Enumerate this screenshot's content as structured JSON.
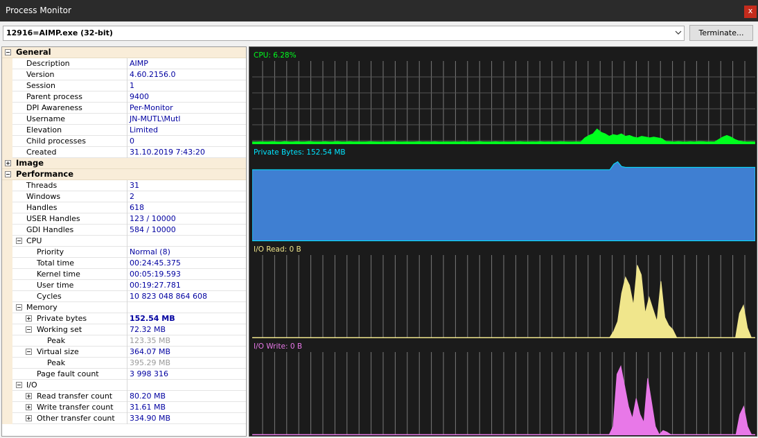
{
  "window": {
    "title": "Process Monitor",
    "close_label": "x"
  },
  "toolbar": {
    "process": "12916=AIMP.exe (32-bit)",
    "terminate_label": "Terminate..."
  },
  "tree": [
    {
      "type": "cat",
      "label": "General",
      "expanded": true
    },
    {
      "label": "Description",
      "value": "AIMP",
      "level": 1
    },
    {
      "label": "Version",
      "value": "4.60.2156.0",
      "level": 1
    },
    {
      "label": "Session",
      "value": "1",
      "level": 1
    },
    {
      "label": "Parent process",
      "value": "9400",
      "level": 1
    },
    {
      "label": "DPI Awareness",
      "value": "Per-Monitor",
      "level": 1
    },
    {
      "label": "Username",
      "value": "JN-MUTL\\Mutl",
      "level": 1
    },
    {
      "label": "Elevation",
      "value": "Limited",
      "level": 1
    },
    {
      "label": "Child processes",
      "value": "0",
      "level": 1
    },
    {
      "label": "Created",
      "value": "31.10.2019 7:43:20",
      "level": 1
    },
    {
      "type": "cat",
      "label": "Image",
      "expanded": false
    },
    {
      "type": "cat",
      "label": "Performance",
      "expanded": true
    },
    {
      "label": "Threads",
      "value": "31",
      "level": 1
    },
    {
      "label": "Windows",
      "value": "2",
      "level": 1
    },
    {
      "label": "Handles",
      "value": "618",
      "level": 1
    },
    {
      "label": "USER Handles",
      "value": "123 / 10000",
      "level": 1
    },
    {
      "label": "GDI Handles",
      "value": "584 / 10000",
      "level": 1
    },
    {
      "label": "CPU",
      "value": "",
      "level": 1,
      "expander": "minus"
    },
    {
      "label": "Priority",
      "value": "Normal (8)",
      "level": 2
    },
    {
      "label": "Total time",
      "value": "00:24:45.375",
      "level": 2
    },
    {
      "label": "Kernel time",
      "value": "00:05:19.593",
      "level": 2
    },
    {
      "label": "User time",
      "value": "00:19:27.781",
      "level": 2
    },
    {
      "label": "Cycles",
      "value": "10 823 048 864 608",
      "level": 2
    },
    {
      "label": "Memory",
      "value": "",
      "level": 1,
      "expander": "minus"
    },
    {
      "label": "Private bytes",
      "value": "152.54 MB",
      "level": 2,
      "expander": "plus",
      "bold": true
    },
    {
      "label": "Working set",
      "value": "72.32 MB",
      "level": 2,
      "expander": "minus"
    },
    {
      "label": "Peak",
      "value": "123.35 MB",
      "level": 3,
      "dim": true
    },
    {
      "label": "Virtual size",
      "value": "364.07 MB",
      "level": 2,
      "expander": "minus"
    },
    {
      "label": "Peak",
      "value": "395.29 MB",
      "level": 3,
      "dim": true
    },
    {
      "label": "Page fault count",
      "value": "3 998 316",
      "level": 2
    },
    {
      "label": "I/O",
      "value": "",
      "level": 1,
      "expander": "minus"
    },
    {
      "label": "Read transfer count",
      "value": "80.20 MB",
      "level": 2,
      "expander": "plus"
    },
    {
      "label": "Write transfer count",
      "value": "31.61 MB",
      "level": 2,
      "expander": "plus"
    },
    {
      "label": "Other transfer count",
      "value": "334.90 MB",
      "level": 2,
      "expander": "plus"
    }
  ],
  "graphs": [
    {
      "title": "CPU: 6.28%",
      "color": "#00ff1e",
      "grid": true,
      "series": [
        2.0,
        1.8,
        2.1,
        2.0,
        1.9,
        2.2,
        2.0,
        1.8,
        2.3,
        2.1,
        2.0,
        2.2,
        1.9,
        2.0,
        2.4,
        2.1,
        2.0,
        1.9,
        2.2,
        2.0,
        2.1,
        2.3,
        2.0,
        1.9,
        2.2,
        2.0,
        2.1,
        1.9,
        2.0,
        2.2,
        2.1,
        2.0,
        1.8,
        2.0,
        2.1,
        2.2,
        2.0,
        1.9,
        2.1,
        2.0,
        2.0,
        2.2,
        1.9,
        2.1,
        2.0,
        2.2,
        2.0,
        1.9,
        2.1,
        2.0,
        2.1,
        2.0,
        2.2,
        1.9,
        2.0,
        2.1,
        2.3,
        2.0,
        2.0,
        1.9,
        2.2,
        2.0,
        2.1,
        2.0,
        2.0,
        2.1,
        2.2,
        2.0,
        1.9,
        2.1,
        2.0,
        2.2,
        2.0,
        2.1,
        1.9,
        2.0,
        2.2,
        2.1,
        2.0,
        2.0,
        2.1,
        2.0,
        7,
        10,
        12,
        18,
        14,
        12,
        9,
        11,
        10,
        12,
        9,
        10,
        8,
        7,
        9,
        8,
        7,
        8,
        7,
        6,
        2.5,
        2.2,
        2.0,
        2.3,
        2.1,
        2.0,
        2.2,
        2.0,
        2.4,
        2.2,
        2.0,
        2.1,
        2.0,
        5,
        8,
        10,
        8,
        5,
        3,
        2.2,
        2.0,
        2.1,
        2.0
      ]
    },
    {
      "title": "Private Bytes: 152.54 MB",
      "color": "#00e5ff",
      "fill": "#3f7fd2",
      "grid": false,
      "series": [
        88,
        88,
        88,
        88,
        88,
        88,
        88,
        88,
        88,
        88,
        88,
        88,
        88,
        88,
        88,
        88,
        88,
        88,
        88,
        88,
        88,
        88,
        88,
        88,
        88,
        88,
        88,
        88,
        88,
        88,
        88,
        88,
        88,
        88,
        88,
        88,
        88,
        88,
        88,
        88,
        88,
        88,
        88,
        88,
        88,
        88,
        88,
        88,
        88,
        88,
        88,
        88,
        88,
        88,
        88,
        88,
        88,
        88,
        88,
        88,
        88,
        88,
        88,
        88,
        88,
        88,
        88,
        88,
        88,
        88,
        88,
        88,
        88,
        88,
        88,
        88,
        88,
        88,
        88,
        88,
        88,
        88,
        88,
        88,
        88,
        88,
        88,
        88,
        88,
        88,
        88,
        88,
        95,
        98,
        92,
        91,
        91,
        91,
        91,
        91,
        91,
        91,
        91,
        91,
        91,
        91,
        91,
        91,
        91,
        91,
        91,
        91,
        91,
        91,
        91,
        91,
        91,
        91,
        91,
        91,
        91,
        91,
        91,
        91,
        91,
        91,
        91,
        91,
        91
      ]
    },
    {
      "title": "I/O Read: 0 B",
      "color": "#f0e68c",
      "fill": "#f0e68c",
      "grid": true,
      "series": [
        0,
        0,
        0,
        0,
        0,
        0,
        0,
        0,
        0,
        0,
        0,
        0,
        0,
        0,
        0,
        0,
        0,
        0,
        0,
        0,
        0,
        0,
        0,
        0,
        0,
        0,
        0,
        0,
        0,
        0,
        0,
        0,
        0,
        0,
        0,
        0,
        0,
        0,
        0,
        0,
        0,
        0,
        0,
        0,
        0,
        0,
        0,
        0,
        0,
        0,
        0,
        0,
        0,
        0,
        0,
        0,
        0,
        0,
        0,
        0,
        0,
        0,
        0,
        0,
        0,
        0,
        0,
        0,
        0,
        0,
        0,
        0,
        0,
        0,
        0,
        0,
        0,
        0,
        0,
        0,
        0,
        0,
        0,
        0,
        0,
        0,
        0,
        0,
        0,
        0,
        0,
        0,
        8,
        20,
        55,
        75,
        65,
        40,
        90,
        78,
        30,
        50,
        35,
        20,
        70,
        25,
        15,
        10,
        0,
        0,
        0,
        0,
        0,
        0,
        0,
        0,
        0,
        0,
        0,
        0,
        0,
        0,
        0,
        0,
        30,
        40,
        12,
        0,
        0
      ]
    },
    {
      "title": "I/O Write: 0 B",
      "color": "#e878e8",
      "fill": "#e878e8",
      "grid": true,
      "series": [
        0,
        0,
        0,
        0,
        0,
        0,
        0,
        0,
        0,
        0,
        0,
        0,
        0,
        0,
        0,
        0,
        0,
        0,
        0,
        0,
        0,
        0,
        0,
        0,
        0,
        0,
        0,
        0,
        0,
        0,
        0,
        0,
        0,
        0,
        0,
        0,
        0,
        0,
        0,
        0,
        0,
        0,
        0,
        0,
        0,
        0,
        0,
        0,
        0,
        0,
        0,
        0,
        0,
        0,
        0,
        0,
        0,
        0,
        0,
        0,
        0,
        0,
        0,
        0,
        0,
        0,
        0,
        0,
        0,
        0,
        0,
        0,
        0,
        0,
        0,
        0,
        0,
        0,
        0,
        0,
        0,
        0,
        0,
        0,
        0,
        0,
        0,
        0,
        0,
        0,
        0,
        0,
        0,
        0,
        10,
        75,
        85,
        60,
        35,
        20,
        45,
        25,
        15,
        70,
        40,
        10,
        0,
        5,
        3,
        0,
        0,
        0,
        0,
        0,
        0,
        0,
        0,
        0,
        0,
        0,
        0,
        0,
        0,
        0,
        0,
        0,
        0,
        25,
        35,
        10,
        0,
        0
      ]
    }
  ]
}
